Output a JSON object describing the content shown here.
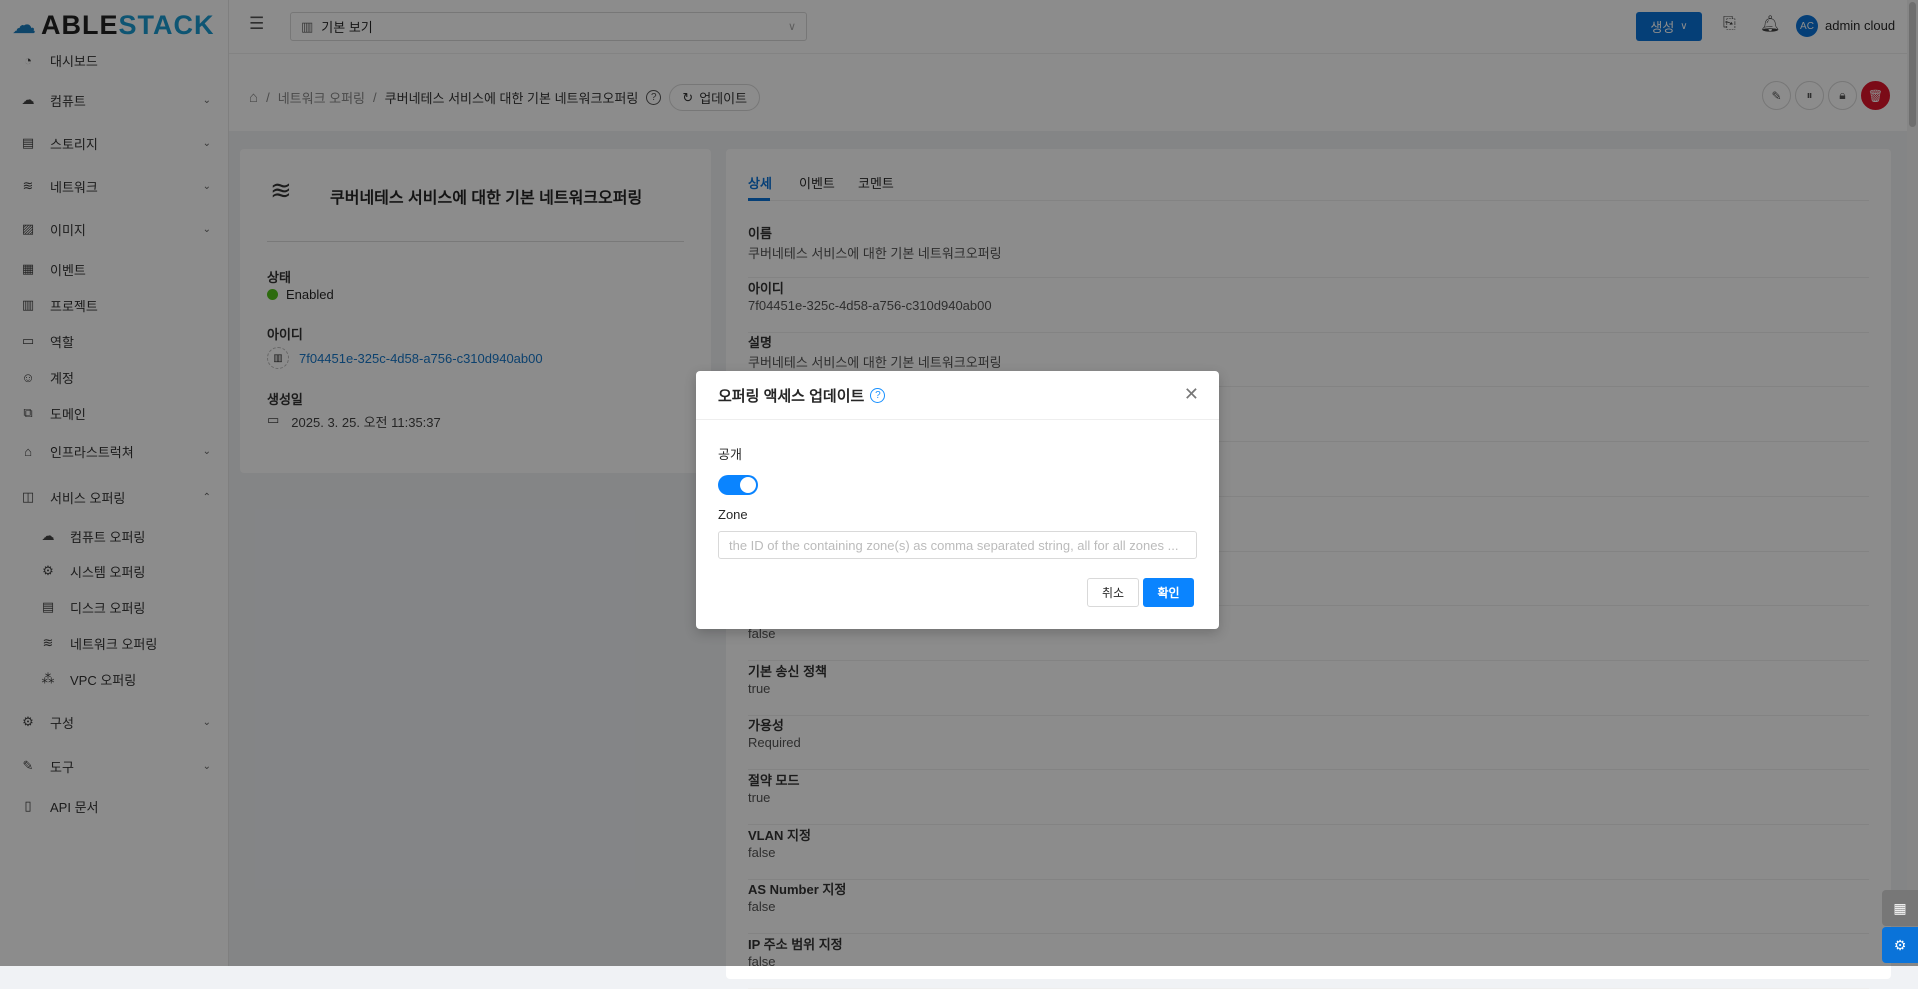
{
  "logo": "ABLESTACK",
  "sidebar": {
    "items": [
      {
        "label": "대시보드",
        "icon": "dashboard-icon",
        "glyph": "◔",
        "chev": ""
      },
      {
        "label": "컴퓨트",
        "icon": "cloud-icon",
        "glyph": "☁",
        "chev": "⌄"
      },
      {
        "label": "스토리지",
        "icon": "storage-icon",
        "glyph": "▤",
        "chev": "⌄"
      },
      {
        "label": "네트워크",
        "icon": "wifi-icon",
        "glyph": "≋",
        "chev": "⌄"
      },
      {
        "label": "이미지",
        "icon": "image-icon",
        "glyph": "▨",
        "chev": "⌄"
      },
      {
        "label": "이벤트",
        "icon": "event-icon",
        "glyph": "▦",
        "chev": ""
      },
      {
        "label": "프로젝트",
        "icon": "project-icon",
        "glyph": "▥",
        "chev": ""
      },
      {
        "label": "역할",
        "icon": "role-icon",
        "glyph": "▭",
        "chev": ""
      },
      {
        "label": "계정",
        "icon": "account-icon",
        "glyph": "☺",
        "chev": ""
      },
      {
        "label": "도메인",
        "icon": "domain-icon",
        "glyph": "⧉",
        "chev": ""
      },
      {
        "label": "인프라스트럭쳐",
        "icon": "bank-icon",
        "glyph": "⌂",
        "chev": "⌄"
      },
      {
        "label": "서비스 오퍼링",
        "icon": "shopping-icon",
        "glyph": "◫",
        "chev": "⌃"
      },
      {
        "label": "컴퓨트 오퍼링",
        "icon": "cloud-icon",
        "glyph": "☁",
        "chev": "",
        "sub": true
      },
      {
        "label": "시스템 오퍼링",
        "icon": "gear-icon",
        "glyph": "⚙",
        "chev": "",
        "sub": true
      },
      {
        "label": "디스크 오퍼링",
        "icon": "storage-icon",
        "glyph": "▤",
        "chev": "",
        "sub": true
      },
      {
        "label": "네트워크 오퍼링",
        "icon": "wifi-icon",
        "glyph": "≋",
        "chev": "",
        "sub": true
      },
      {
        "label": "VPC 오퍼링",
        "icon": "vpc-icon",
        "glyph": "⁂",
        "chev": "",
        "sub": true
      },
      {
        "label": "구성",
        "icon": "gear-icon",
        "glyph": "⚙",
        "chev": "⌄"
      },
      {
        "label": "도구",
        "icon": "tool-icon",
        "glyph": "✎",
        "chev": "⌄"
      },
      {
        "label": "API 문서",
        "icon": "book-icon",
        "glyph": "▯",
        "chev": ""
      }
    ]
  },
  "header": {
    "view_select": "기본 보기",
    "create": "생성",
    "user": "admin cloud",
    "avatar": "AC"
  },
  "breadcrumb": {
    "parent": "네트워크 오퍼링",
    "current": "쿠버네테스 서비스에 대한 기본 네트워크오퍼링",
    "update": "업데이트"
  },
  "summary": {
    "title": "쿠버네테스 서비스에 대한 기본 네트워크오퍼링",
    "state_label": "상태",
    "state": "Enabled",
    "state_color": "#52c41a",
    "id_label": "아이디",
    "id": "7f04451e-325c-4d58-a756-c310d940ab00",
    "created_label": "생성일",
    "created": "2025. 3. 25. 오전 11:35:37"
  },
  "tabs": [
    "상세",
    "이벤트",
    "코멘트"
  ],
  "details": [
    {
      "label": "이름",
      "value": "쿠버네테스 서비스에 대한 기본 네트워크오퍼링"
    },
    {
      "label": "아이디",
      "value": "7f04451e-325c-4d58-a756-c310d940ab00"
    },
    {
      "label": "설명",
      "value": "쿠버네테스 서비스에 대한 기본 네트워크오퍼링"
    },
    {
      "label": "",
      "value": ""
    },
    {
      "label": "",
      "value": ""
    },
    {
      "label": "",
      "value": ""
    },
    {
      "label": "",
      "value": ""
    },
    {
      "label": "",
      "value": "false"
    },
    {
      "label": "기본 송신 정책",
      "value": "true"
    },
    {
      "label": "가용성",
      "value": "Required"
    },
    {
      "label": "절약 모드",
      "value": "true"
    },
    {
      "label": "VLAN 지정",
      "value": "false"
    },
    {
      "label": "AS Number 지정",
      "value": "false"
    },
    {
      "label": "IP 주소 범위 지정",
      "value": "false"
    }
  ],
  "modal": {
    "title": "오퍼링 액세스 업데이트",
    "public_label": "공개",
    "public": true,
    "zone_label": "Zone",
    "zone_placeholder": "the ID of the containing zone(s) as comma separated string, all for all zones ...",
    "cancel": "취소",
    "ok": "확인"
  }
}
